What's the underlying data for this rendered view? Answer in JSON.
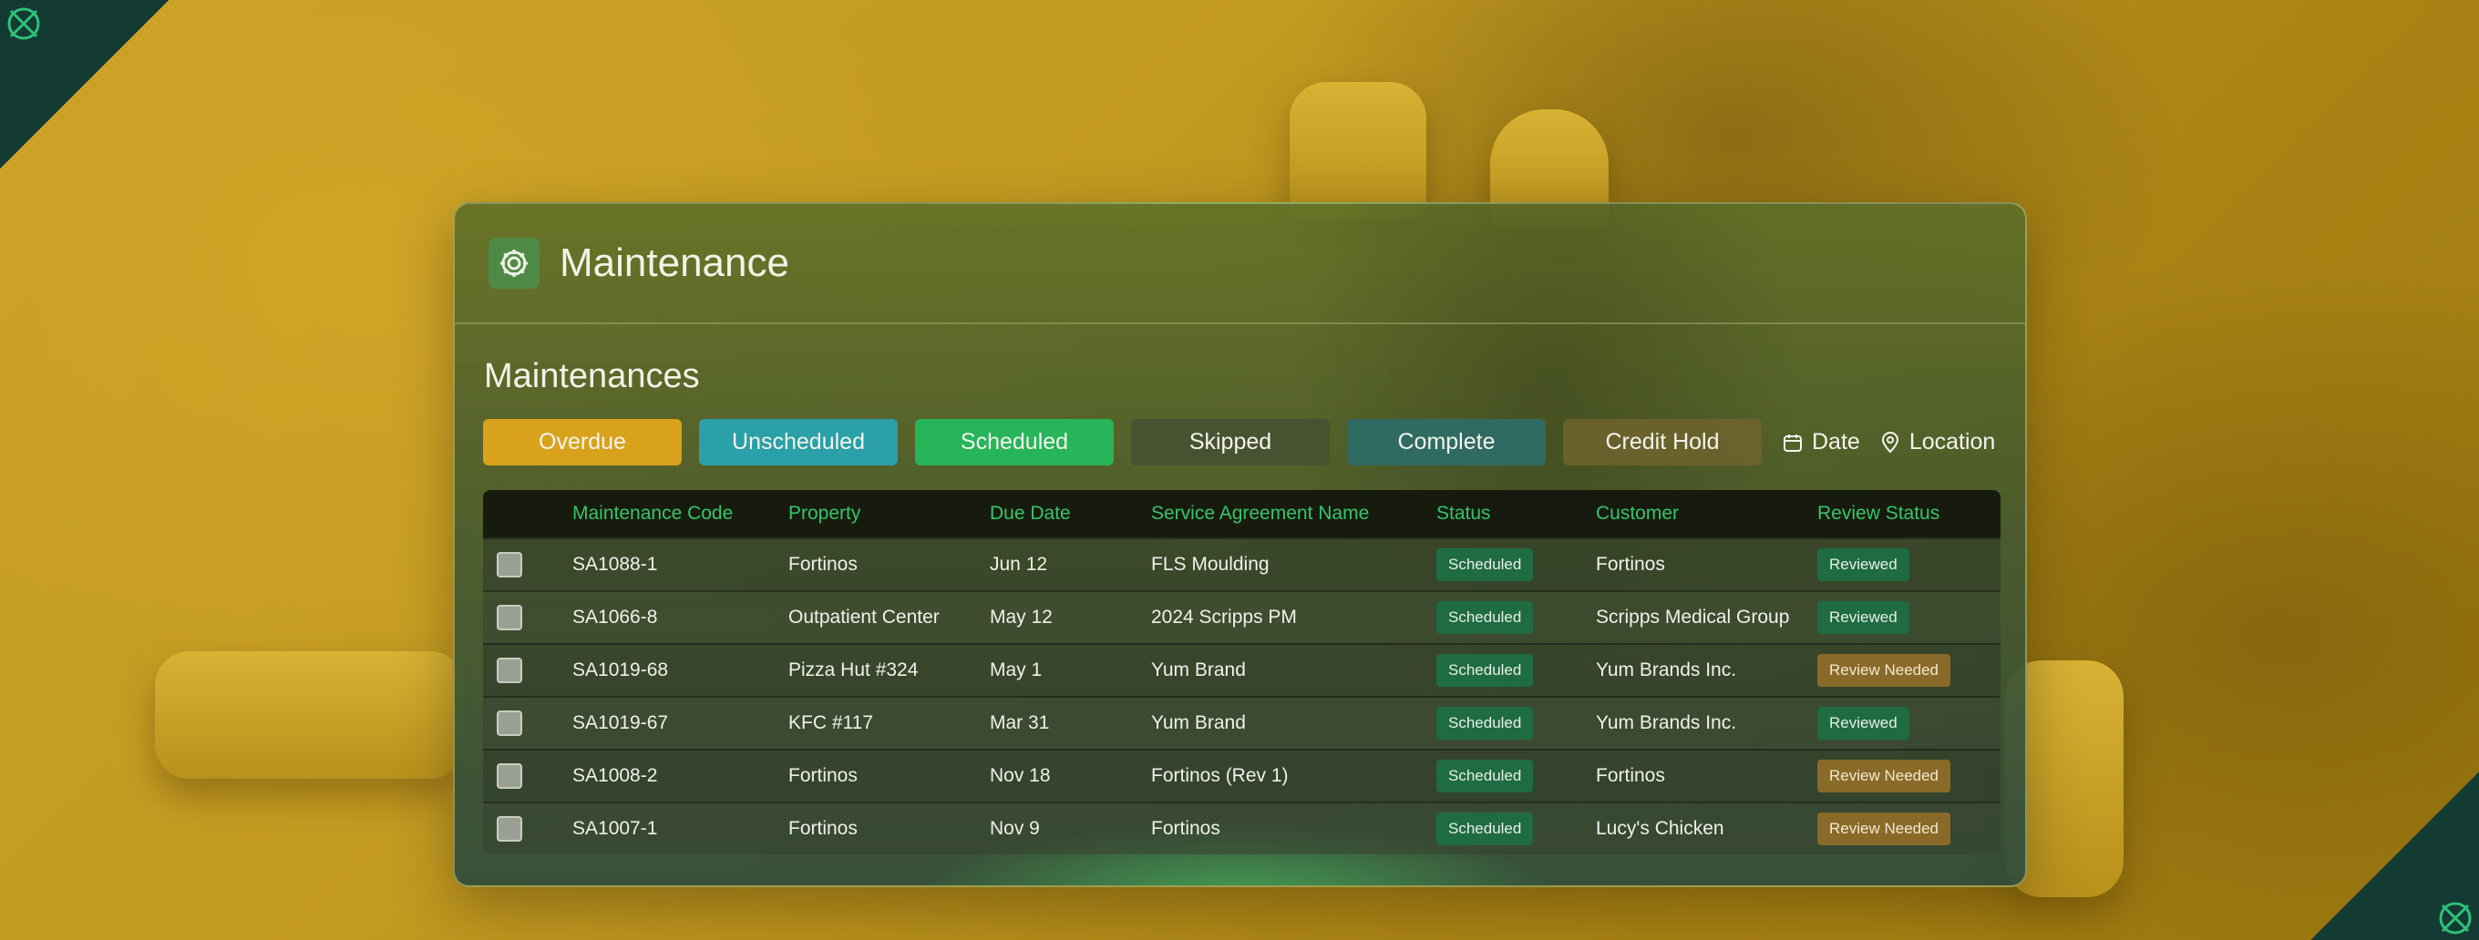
{
  "app": {
    "title": "Maintenance",
    "icon": "gear-icon"
  },
  "section": {
    "title": "Maintenances"
  },
  "filters": {
    "tabs": [
      {
        "label": "Overdue",
        "color": "#d8a21d"
      },
      {
        "label": "Unscheduled",
        "color": "#2aa0a8"
      },
      {
        "label": "Scheduled",
        "color": "#27b45a"
      },
      {
        "label": "Skipped",
        "color": "#465032"
      },
      {
        "label": "Complete",
        "color": "#2f6b62"
      },
      {
        "label": "Credit Hold",
        "color": "#6e642d"
      }
    ],
    "date_label": "Date",
    "location_label": "Location"
  },
  "table": {
    "headers": [
      "Maintenance Code",
      "Property",
      "Due Date",
      "Service Agreement Name",
      "Status",
      "Customer",
      "Review Status"
    ],
    "rows": [
      {
        "code": "SA1088-1",
        "property": "Fortinos",
        "due": "Jun 12",
        "agreement": "FLS Moulding",
        "status": "Scheduled",
        "customer": "Fortinos",
        "review": "Reviewed"
      },
      {
        "code": "SA1066-8",
        "property": "Outpatient Center",
        "due": "May 12",
        "agreement": "2024 Scripps PM",
        "status": "Scheduled",
        "customer": "Scripps Medical Group",
        "review": "Reviewed"
      },
      {
        "code": "SA1019-68",
        "property": "Pizza Hut #324",
        "due": "May 1",
        "agreement": "Yum Brand",
        "status": "Scheduled",
        "customer": "Yum Brands Inc.",
        "review": "Review Needed"
      },
      {
        "code": "SA1019-67",
        "property": "KFC #117",
        "due": "Mar 31",
        "agreement": "Yum Brand",
        "status": "Scheduled",
        "customer": "Yum Brands Inc.",
        "review": "Reviewed"
      },
      {
        "code": "SA1008-2",
        "property": "Fortinos",
        "due": "Nov 18",
        "agreement": "Fortinos (Rev 1)",
        "status": "Scheduled",
        "customer": "Fortinos",
        "review": "Review Needed"
      },
      {
        "code": "SA1007-1",
        "property": "Fortinos",
        "due": "Nov 9",
        "agreement": "Fortinos",
        "status": "Scheduled",
        "customer": "Lucy's Chicken",
        "review": "Review Needed"
      }
    ]
  },
  "colors": {
    "accent_green": "#37c46a",
    "badge_green": "#1f6b42",
    "badge_amber": "#8a6a28",
    "corner": "#143a34"
  }
}
